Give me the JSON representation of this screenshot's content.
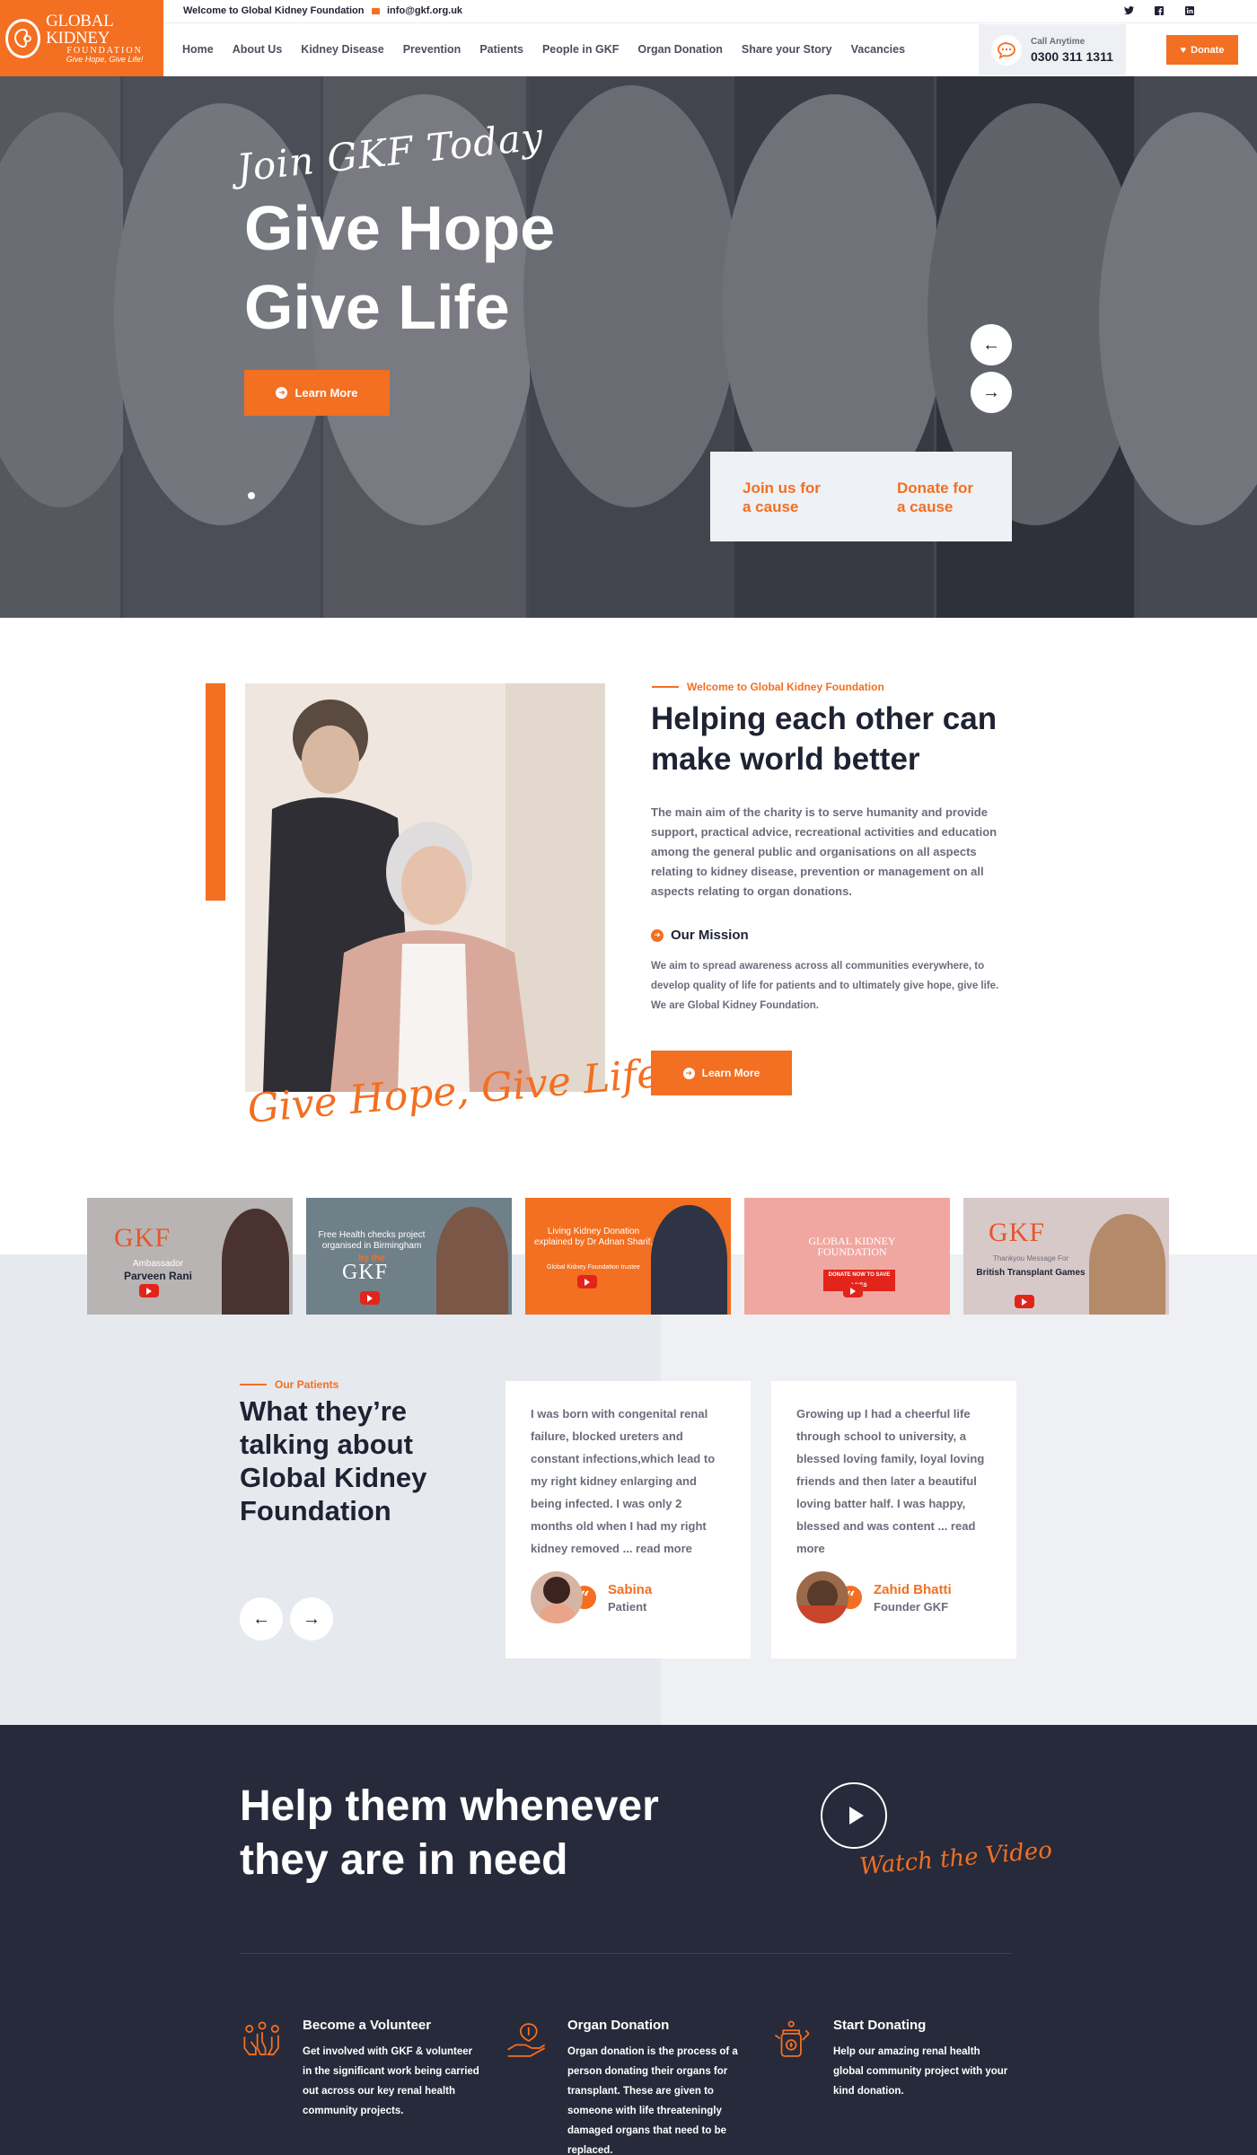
{
  "brand": {
    "name_line1": "GLOBAL KIDNEY",
    "name_line2": "FOUNDATION",
    "tagline": "Give Hope, Give Life!"
  },
  "topbar": {
    "welcome": "Welcome to Global Kidney Foundation",
    "email": "info@gkf.org.uk",
    "socials": [
      "twitter-icon",
      "facebook-icon",
      "linkedin-icon"
    ]
  },
  "nav": {
    "items": [
      "Home",
      "About Us",
      "Kidney Disease",
      "Prevention",
      "Patients",
      "People in GKF",
      "Organ Donation",
      "Share your Story",
      "Vacancies"
    ]
  },
  "call": {
    "label": "Call Anytime",
    "number": "0300 311 1311"
  },
  "donate": {
    "label": "Donate"
  },
  "hero": {
    "script": "Join GKF Today",
    "title_line1": "Give Hope",
    "title_line2": "Give Life",
    "button": "Learn More",
    "join_label": "Join us for a cause",
    "donate_label": "Donate for a cause"
  },
  "about": {
    "eyebrow": "Welcome to Global Kidney Foundation",
    "title": "Helping each other can make world better",
    "paragraph": "The main aim of the charity is to serve humanity and provide support, practical advice, recreational activities and education among the general public and organisations on all aspects relating to kidney disease, prevention or management on all aspects relating to organ donations.",
    "mission_title": "Our Mission",
    "mission_text": "We aim to spread awareness across all communities everywhere, to develop quality of life for patients and to ultimately give hope, give life. We are Global Kidney Foundation.",
    "button": "Learn More",
    "script": "Give Hope, Give Life"
  },
  "videos": [
    {
      "title": "GKF",
      "sub1": "Ambassador",
      "sub2": "Parveen Rani"
    },
    {
      "title": "GKF",
      "sub1": "Free Health checks project organised in Birmingham",
      "sub2": "by the"
    },
    {
      "title": "",
      "sub1": "Living Kidney Donation explained by Dr Adnan Sharif,",
      "sub2": "Global Kidney Foundation trustee"
    },
    {
      "title": "GLOBAL KIDNEY FOUNDATION",
      "sub1": "DONATE NOW TO SAVE LIVES",
      "sub2": ""
    },
    {
      "title": "GKF",
      "sub1": "Thankyou Message For",
      "sub2": "British Transplant Games"
    }
  ],
  "patients": {
    "eyebrow": "Our Patients",
    "title": "What they’re talking about Global Kidney Foundation",
    "testimonials": [
      {
        "text": "I was born with congenital renal failure, blocked ureters and constant infections,which lead to my right kidney enlarging and being infected. I was only 2 months old when I had my right kidney removed ... read more",
        "name": "Sabina",
        "role": "Patient"
      },
      {
        "text": "Growing up I had a cheerful life through school to university, a blessed loving family, loyal loving friends and then later a beautiful loving batter half. I was happy, blessed and was content ... read more",
        "name": "Zahid Bhatti",
        "role": "Founder GKF"
      }
    ]
  },
  "help": {
    "title_line1": "Help them whenever",
    "title_line2": "they are in need",
    "watch": "Watch the Video",
    "features": [
      {
        "title": "Become a Volunteer",
        "text": "Get involved with GKF & volunteer in the significant work being carried out across our key renal health community projects.",
        "icon": "volunteer-hands-icon"
      },
      {
        "title": "Organ Donation",
        "text": "Organ donation is the process of a person donating their organs for transplant. These are given to someone with life threateningly damaged organs that need to be replaced.",
        "icon": "organ-donation-hand-icon"
      },
      {
        "title": "Start Donating",
        "text": "Help our amazing renal health global community project with your kind donation.",
        "icon": "donation-jar-icon"
      }
    ]
  },
  "colors": {
    "accent": "#f36f21",
    "dark": "#262a3a",
    "grey": "#eef0f4"
  }
}
